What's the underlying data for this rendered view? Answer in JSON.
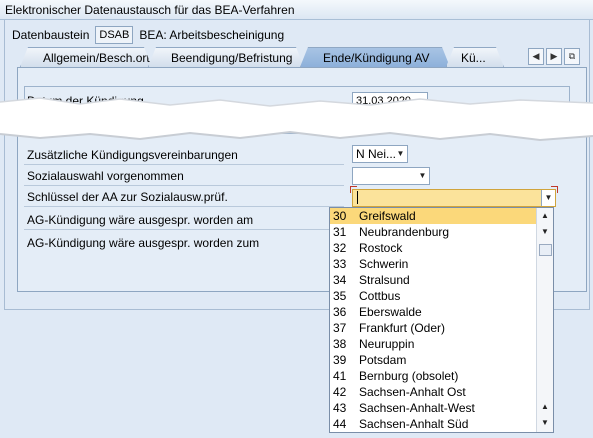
{
  "window": {
    "title": "Elektronischer Datenaustausch für das BEA-Verfahren"
  },
  "header": {
    "label": "Datenbaustein",
    "code": "DSAB",
    "description": "BEA: Arbeitsbescheinigung"
  },
  "tabs": [
    {
      "label": "Allgemein/Besch.ort"
    },
    {
      "label": "Beendigung/Befristung"
    },
    {
      "label": "Ende/Kündigung AV"
    },
    {
      "label": "Kü..."
    }
  ],
  "tab_nav": {
    "prev_icon": "arrow-left-icon",
    "next_icon": "arrow-right-icon",
    "list_icon": "tab-list-icon"
  },
  "upper": {
    "label_partial": "Datum der Kündigung",
    "date_value": "31.03.2020"
  },
  "form": {
    "rows": [
      {
        "label": "Zusätzliche Kündigungsvereinbarungen",
        "value": "N Nei..."
      },
      {
        "label": "Sozialauswahl vorgenommen",
        "value": ""
      },
      {
        "label": "Schlüssel der AA zur Sozialausw.prüf.",
        "value": ""
      },
      {
        "label": "AG-Kündigung wäre ausgespr. worden am",
        "value": ""
      },
      {
        "label": "AG-Kündigung wäre ausgespr. worden zum",
        "value": ""
      }
    ]
  },
  "dropdown_list": {
    "items": [
      {
        "code": "30",
        "name": "Greifswald"
      },
      {
        "code": "31",
        "name": "Neubrandenburg"
      },
      {
        "code": "32",
        "name": "Rostock"
      },
      {
        "code": "33",
        "name": "Schwerin"
      },
      {
        "code": "34",
        "name": "Stralsund"
      },
      {
        "code": "35",
        "name": "Cottbus"
      },
      {
        "code": "36",
        "name": "Eberswalde"
      },
      {
        "code": "37",
        "name": "Frankfurt (Oder)"
      },
      {
        "code": "38",
        "name": "Neuruppin"
      },
      {
        "code": "39",
        "name": "Potsdam"
      },
      {
        "code": "41",
        "name": "Bernburg (obsolet)"
      },
      {
        "code": "42",
        "name": "Sachsen-Anhalt Ost"
      },
      {
        "code": "43",
        "name": "Sachsen-Anhalt-West"
      },
      {
        "code": "44",
        "name": "Sachsen-Anhalt Süd"
      }
    ],
    "selected_index": 0
  },
  "colors": {
    "selection": "#fbd87a",
    "focus_field": "#fbe39b",
    "panel": "#e4edf7",
    "tab_active": "#8db0da"
  }
}
